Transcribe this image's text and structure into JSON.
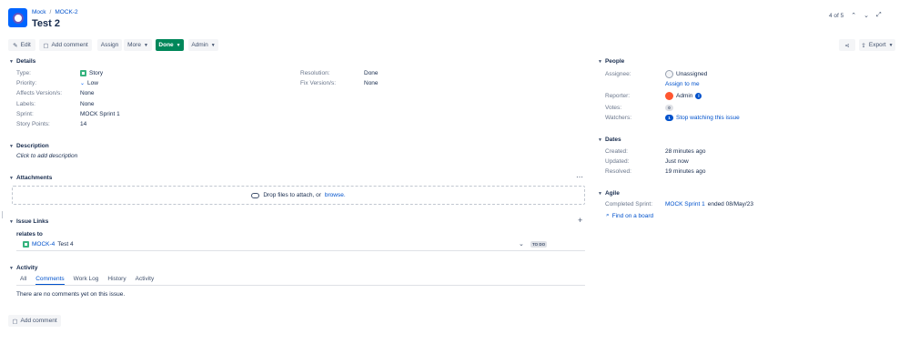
{
  "header": {
    "breadcrumbs": [
      "Mock",
      "MOCK-2"
    ],
    "title": "Test 2",
    "pager": "4 of 5"
  },
  "toolbar": {
    "edit": "Edit",
    "add_comment": "Add comment",
    "assign": "Assign",
    "more": "More",
    "status": "Done",
    "admin": "Admin",
    "export": "Export"
  },
  "details": {
    "heading": "Details",
    "left": [
      {
        "label": "Type:",
        "value": "Story"
      },
      {
        "label": "Priority:",
        "value": "Low"
      },
      {
        "label": "Affects Version/s:",
        "value": "None"
      },
      {
        "label": "Labels:",
        "value": "None"
      },
      {
        "label": "Sprint:",
        "value": "MOCK Sprint 1"
      },
      {
        "label": "Story Points:",
        "value": "14"
      }
    ],
    "right": [
      {
        "label": "Resolution:",
        "value": "Done"
      },
      {
        "label": "Fix Version/s:",
        "value": "None"
      }
    ]
  },
  "description": {
    "heading": "Description",
    "placeholder": "Click to add description"
  },
  "attachments": {
    "heading": "Attachments",
    "drop_text": "Drop files to attach, or",
    "browse": "browse."
  },
  "issue_links": {
    "heading": "Issue Links",
    "relation": "relates to",
    "key": "MOCK-4",
    "summary": "Test 4",
    "status": "TO DO"
  },
  "activity": {
    "heading": "Activity",
    "tabs": [
      "All",
      "Comments",
      "Work Log",
      "History",
      "Activity"
    ],
    "active_tab": "Comments",
    "empty": "There are no comments yet on this issue.",
    "add_comment": "Add comment"
  },
  "people": {
    "heading": "People",
    "assignee_label": "Assignee:",
    "assignee": "Unassigned",
    "assign_to_me": "Assign to me",
    "reporter_label": "Reporter:",
    "reporter": "Admin",
    "votes_label": "Votes:",
    "votes": "0",
    "watchers_label": "Watchers:",
    "watchers": "1",
    "watch_action": "Stop watching this issue"
  },
  "dates": {
    "heading": "Dates",
    "created_label": "Created:",
    "created": "28 minutes ago",
    "updated_label": "Updated:",
    "updated": "Just now",
    "resolved_label": "Resolved:",
    "resolved": "19 minutes ago"
  },
  "agile": {
    "heading": "Agile",
    "completed_label": "Completed Sprint:",
    "sprint": "MOCK Sprint 1",
    "ended": "ended 08/May/23",
    "find_board": "Find on a board"
  },
  "colors": {
    "accent": "#0052cc",
    "done": "#00875a",
    "story": "#36b37e"
  }
}
